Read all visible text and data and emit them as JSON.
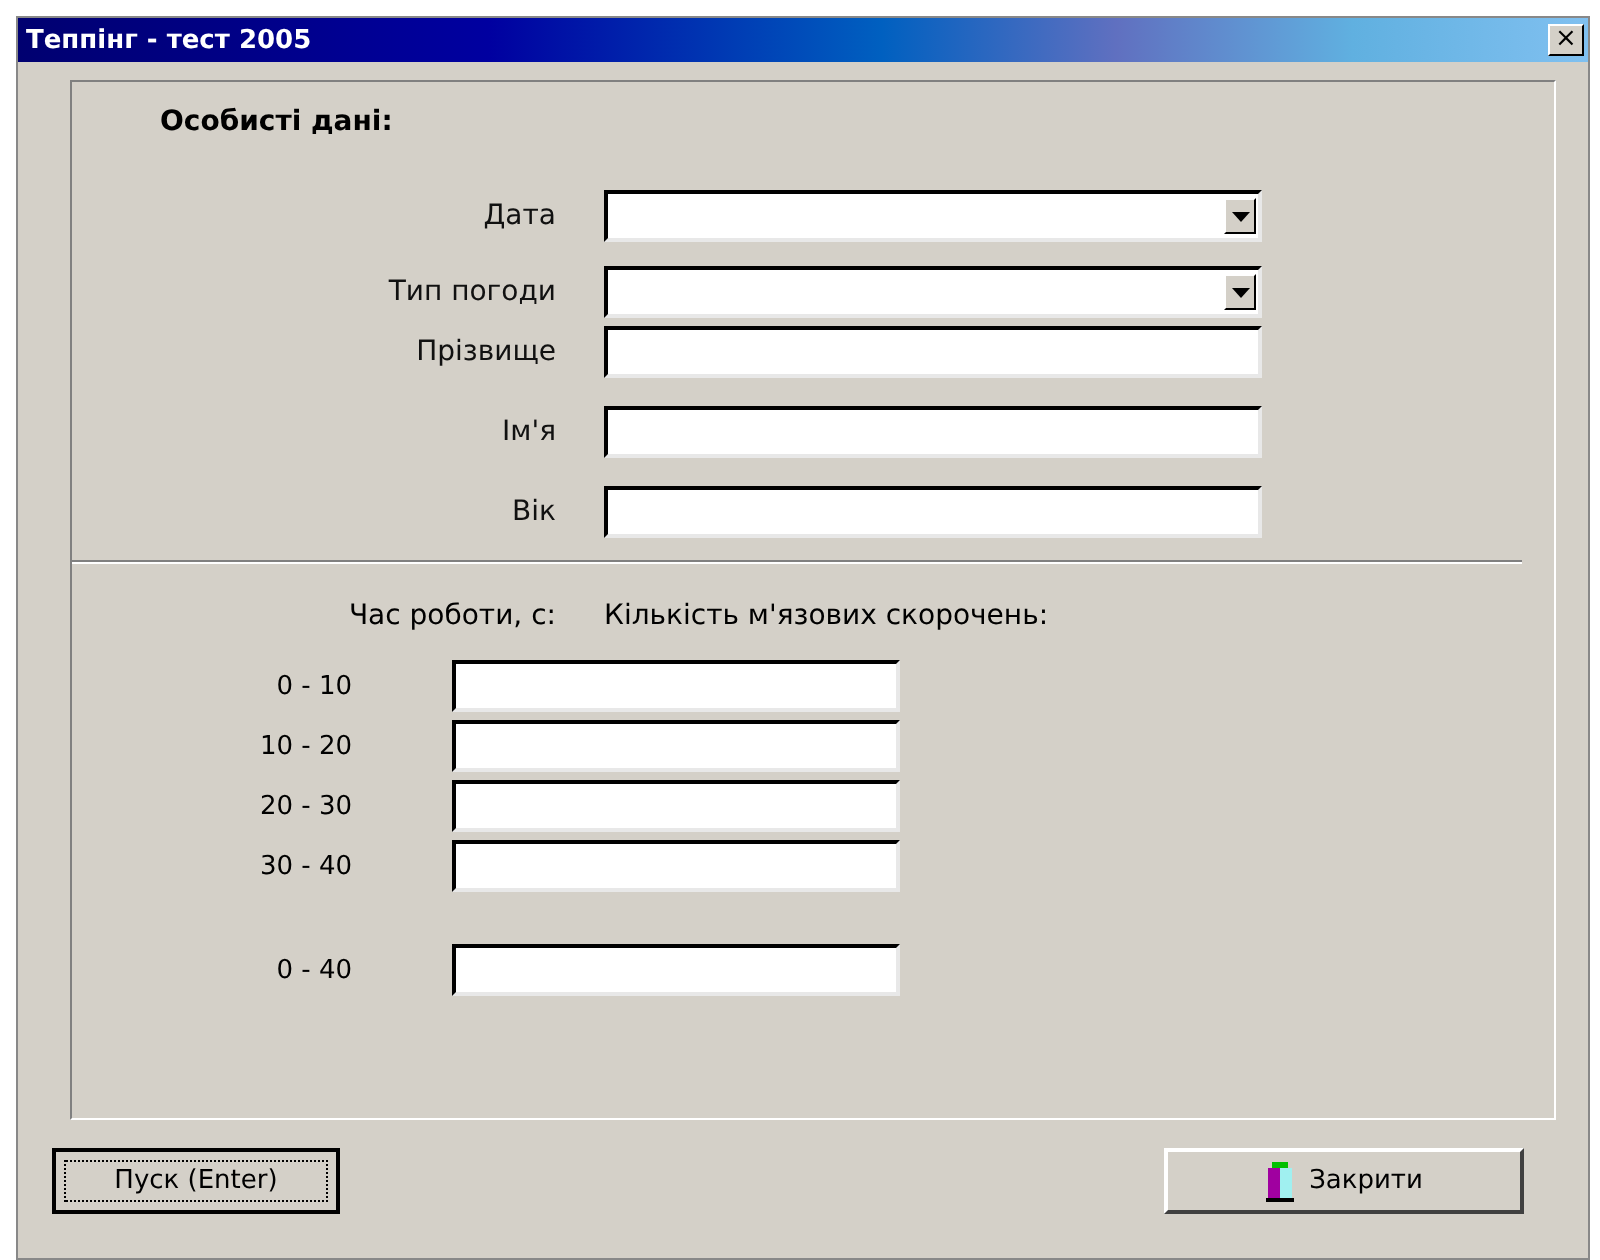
{
  "window": {
    "title": "Теппінг - тест 2005",
    "close_label": "×"
  },
  "personal": {
    "heading": "Особисті дані:",
    "fields": [
      {
        "label": "Дата",
        "kind": "combo"
      },
      {
        "label": "Тип погоди",
        "kind": "combo"
      },
      {
        "label": "Прізвище",
        "kind": "text"
      },
      {
        "label": "Ім'я",
        "kind": "text"
      },
      {
        "label": "Вік",
        "kind": "text"
      }
    ]
  },
  "results": {
    "time_heading": "Час роботи, с:",
    "count_heading": "Кількість м'язових скорочень:",
    "rows": [
      {
        "label": "0 - 10",
        "kind": "interval"
      },
      {
        "label": "10 - 20",
        "kind": "interval"
      },
      {
        "label": "20 - 30",
        "kind": "interval"
      },
      {
        "label": "30 - 40",
        "kind": "interval"
      },
      {
        "label": "0 - 40",
        "kind": "total"
      }
    ]
  },
  "buttons": [
    {
      "label": "Пуск (Enter)",
      "kind": "default"
    },
    {
      "label": "Закрити",
      "kind": "close"
    }
  ]
}
